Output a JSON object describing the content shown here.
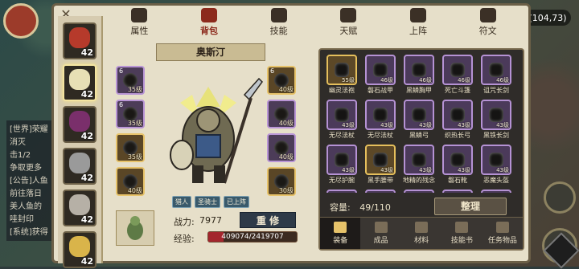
{
  "hud": {
    "coords": "(104,73)"
  },
  "chat": {
    "lines": [
      "[世界]荣耀",
      "消灭",
      "击1/2",
      "争取更多",
      "[公告]人鱼",
      "前往落日",
      "美人鱼的",
      "哇封印",
      "[系统]获得"
    ]
  },
  "characters": [
    {
      "level": "42",
      "selected": false,
      "color": "#b63a2b"
    },
    {
      "level": "42",
      "selected": true,
      "color": "#e7e0b5"
    },
    {
      "level": "42",
      "selected": false,
      "color": "#7a2f6b"
    },
    {
      "level": "42",
      "selected": false,
      "color": "#9a9a9a"
    },
    {
      "level": "42",
      "selected": false,
      "color": "#b6b0a6"
    },
    {
      "level": "42",
      "selected": false,
      "color": "#d9b44a"
    }
  ],
  "tabs": [
    {
      "label": "属性",
      "icon": "flame-icon",
      "active": false
    },
    {
      "label": "背包",
      "icon": "bag-icon",
      "active": true
    },
    {
      "label": "技能",
      "icon": "book-icon",
      "active": false
    },
    {
      "label": "天赋",
      "icon": "eye-icon",
      "active": false
    },
    {
      "label": "上阵",
      "icon": "swords-icon",
      "active": false
    },
    {
      "label": "符文",
      "icon": "house-icon",
      "active": false
    }
  ],
  "hero": {
    "name": "奥斯汀",
    "badges": [
      "猎人",
      "圣骑士",
      "已上阵"
    ],
    "power_label": "战力:",
    "power_value": "7977",
    "repair_label": "重 修",
    "exp_label": "经验:",
    "exp_text": "409074/2419707",
    "exp_fraction": 0.169
  },
  "equip_slots_left": [
    {
      "num": "6",
      "level": "35级",
      "style": "purple"
    },
    {
      "num": "6",
      "level": "35级",
      "style": "purple"
    },
    {
      "num": "",
      "level": "35级",
      "style": "gold"
    },
    {
      "num": "",
      "level": "40级",
      "style": "gold"
    }
  ],
  "equip_slots_right": [
    {
      "num": "6",
      "level": "40级",
      "style": "gold"
    },
    {
      "num": "",
      "level": "40级",
      "style": "purple"
    },
    {
      "num": "",
      "level": "40级",
      "style": "purple"
    },
    {
      "num": "",
      "level": "30级",
      "style": "gold"
    }
  ],
  "bag": {
    "items": [
      {
        "name": "幽灵法袍",
        "level": "55级",
        "style": "gold"
      },
      {
        "name": "磐石战甲",
        "level": "46级",
        "style": "purple"
      },
      {
        "name": "黑鳞胸甲",
        "level": "46级",
        "style": "purple"
      },
      {
        "name": "死亡斗篷",
        "level": "46级",
        "style": "purple"
      },
      {
        "name": "诅咒长剑",
        "level": "46级",
        "style": "purple"
      },
      {
        "name": "无尽法杖",
        "level": "43级",
        "style": "purple"
      },
      {
        "name": "无尽法杖",
        "level": "43级",
        "style": "purple"
      },
      {
        "name": "黑鳞弓",
        "level": "43级",
        "style": "purple"
      },
      {
        "name": "织热长弓",
        "level": "43级",
        "style": "purple"
      },
      {
        "name": "黑铁长剑",
        "level": "43级",
        "style": "purple"
      },
      {
        "name": "无尽护腕",
        "level": "43级",
        "style": "purple"
      },
      {
        "name": "黑手腰带",
        "level": "43级",
        "style": "gold"
      },
      {
        "name": "地精的残念",
        "level": "43级",
        "style": "purple"
      },
      {
        "name": "磐石靴",
        "level": "43级",
        "style": "purple"
      },
      {
        "name": "恶魔头盔",
        "level": "43级",
        "style": "purple"
      },
      {
        "name": "",
        "level": "",
        "style": "purple"
      },
      {
        "name": "",
        "level": "",
        "style": "purple"
      },
      {
        "name": "",
        "level": "",
        "style": "purple"
      },
      {
        "name": "",
        "level": "",
        "style": "purple"
      },
      {
        "name": "",
        "level": "",
        "style": "purple"
      }
    ],
    "capacity_label": "容量:",
    "capacity_value": "49/110",
    "sort_label": "整理",
    "tabs": [
      {
        "label": "装备",
        "icon": "hammer-icon",
        "active": true
      },
      {
        "label": "成品",
        "icon": "potion-icon",
        "active": false
      },
      {
        "label": "材料",
        "icon": "ore-icon",
        "active": false
      },
      {
        "label": "技能书",
        "icon": "skillbook-icon",
        "active": false
      },
      {
        "label": "任务物品",
        "icon": "quest-icon",
        "active": false
      }
    ]
  }
}
